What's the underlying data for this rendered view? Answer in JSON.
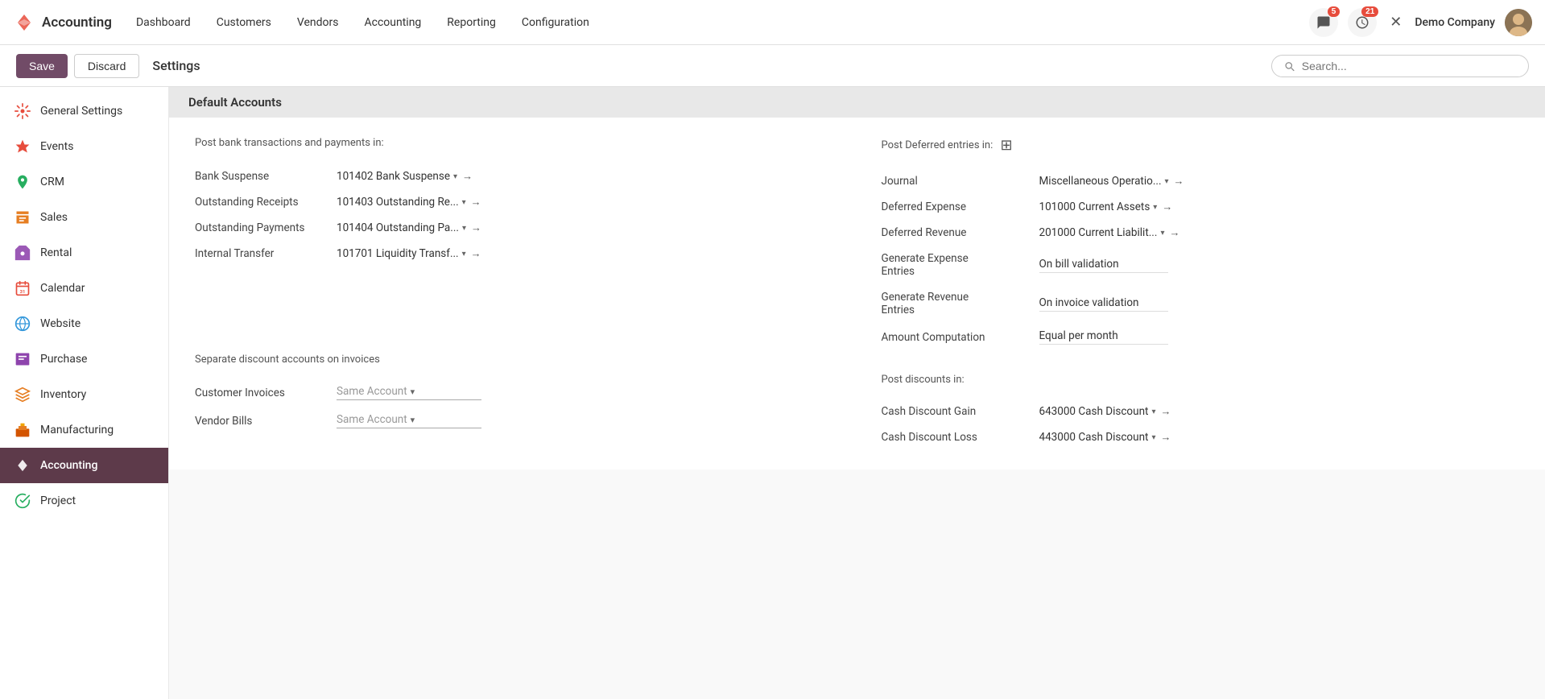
{
  "app": {
    "brand": "Accounting",
    "nav_links": [
      "Dashboard",
      "Customers",
      "Vendors",
      "Accounting",
      "Reporting",
      "Configuration"
    ],
    "notifications_count": "5",
    "activities_count": "21",
    "company": "Demo Company"
  },
  "toolbar": {
    "save_label": "Save",
    "discard_label": "Discard",
    "page_title": "Settings",
    "search_placeholder": "Search..."
  },
  "sidebar": {
    "items": [
      {
        "label": "General Settings",
        "color": "#e74c3c",
        "icon": "settings"
      },
      {
        "label": "Events",
        "color": "#e74c3c",
        "icon": "events"
      },
      {
        "label": "CRM",
        "color": "#27ae60",
        "icon": "crm"
      },
      {
        "label": "Sales",
        "color": "#e67e22",
        "icon": "sales"
      },
      {
        "label": "Rental",
        "color": "#9b59b6",
        "icon": "rental"
      },
      {
        "label": "Calendar",
        "color": "#e74c3c",
        "icon": "calendar"
      },
      {
        "label": "Website",
        "color": "#3498db",
        "icon": "website"
      },
      {
        "label": "Purchase",
        "color": "#8e44ad",
        "icon": "purchase"
      },
      {
        "label": "Inventory",
        "color": "#e67e22",
        "icon": "inventory"
      },
      {
        "label": "Manufacturing",
        "color": "#d35400",
        "icon": "manufacturing"
      },
      {
        "label": "Accounting",
        "color": "#e74c3c",
        "icon": "accounting",
        "active": true
      },
      {
        "label": "Project",
        "color": "#27ae60",
        "icon": "project"
      }
    ]
  },
  "content": {
    "section_title": "Default Accounts",
    "bank_section_title": "Post bank transactions and payments in:",
    "bank_fields": [
      {
        "label": "Bank Suspense",
        "value": "101402 Bank Suspense"
      },
      {
        "label": "Outstanding Receipts",
        "value": "101403 Outstanding Re..."
      },
      {
        "label": "Outstanding Payments",
        "value": "101404 Outstanding Pa..."
      },
      {
        "label": "Internal Transfer",
        "value": "101701 Liquidity Transf..."
      }
    ],
    "deferred_section_title": "Post Deferred entries in:",
    "deferred_fields": [
      {
        "label": "Journal",
        "value": "Miscellaneous Operatio..."
      },
      {
        "label": "Deferred Expense",
        "value": "101000 Current Assets"
      },
      {
        "label": "Deferred Revenue",
        "value": "201000 Current Liabilit..."
      },
      {
        "label": "Generate Expense Entries",
        "value": "On bill validation",
        "static": true
      },
      {
        "label": "Generate Revenue Entries",
        "value": "On invoice validation",
        "static": true
      },
      {
        "label": "Amount Computation",
        "value": "Equal per month",
        "static": true
      }
    ],
    "discount_section_title": "Separate discount accounts on invoices",
    "discount_fields": [
      {
        "label": "Customer Invoices",
        "value": "Same Account",
        "placeholder": true
      },
      {
        "label": "Vendor Bills",
        "value": "Same Account",
        "placeholder": true
      }
    ],
    "post_discounts_title": "Post discounts in:",
    "post_discount_fields": [
      {
        "label": "Cash Discount Gain",
        "value": "643000 Cash Discount"
      },
      {
        "label": "Cash Discount Loss",
        "value": "443000 Cash Discount"
      }
    ]
  }
}
